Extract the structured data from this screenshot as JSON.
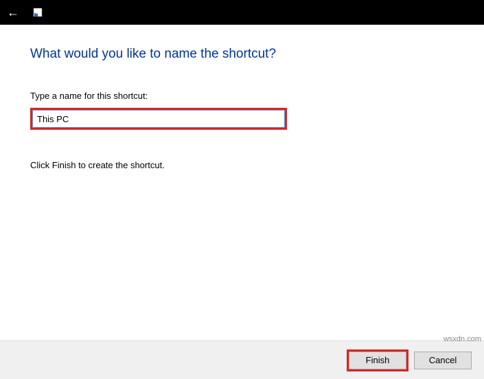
{
  "header": {
    "back_label": "←"
  },
  "wizard": {
    "heading": "What would you like to name the shortcut?",
    "input_label": "Type a name for this shortcut:",
    "input_value": "This PC",
    "instruction": "Click Finish to create the shortcut."
  },
  "footer": {
    "finish_label": "Finish",
    "cancel_label": "Cancel"
  },
  "watermark": "wsxdn.com"
}
